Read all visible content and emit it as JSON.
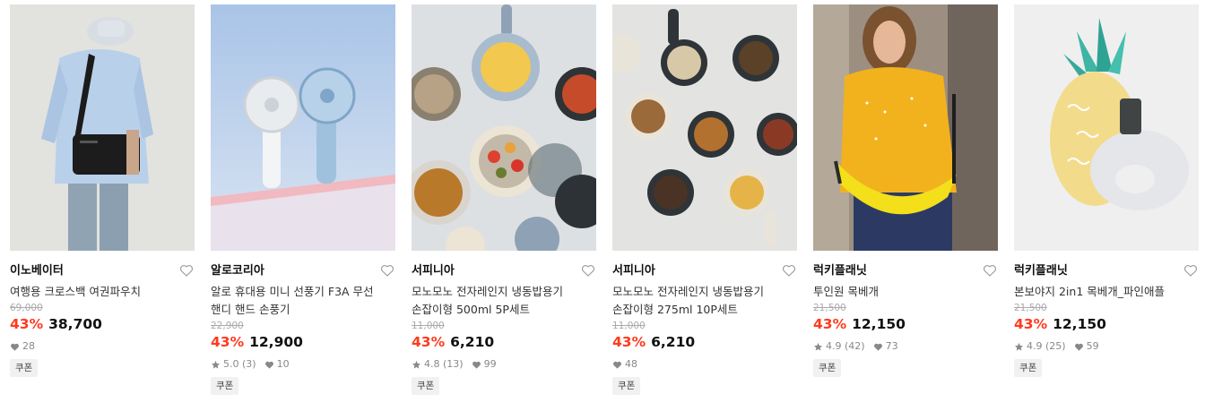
{
  "products": [
    {
      "brand": "이노베이터",
      "title": "여행용 크로스백 여권파우치",
      "original_price": "69,000",
      "discount": "43%",
      "price": "38,700",
      "rating": "",
      "review_count": "",
      "likes": "28",
      "badge": "쿠폰"
    },
    {
      "brand": "알로코리아",
      "title": "알로 휴대용 미니 선풍기 F3A 무선 핸디 핸드 손풍기",
      "original_price": "22,900",
      "discount": "43%",
      "price": "12,900",
      "rating": "5.0",
      "review_count": "(3)",
      "likes": "10",
      "badge": "쿠폰"
    },
    {
      "brand": "서피니아",
      "title": "모노모노 전자레인지 냉동밥용기 손잡이형 500ml 5P세트",
      "original_price": "11,000",
      "discount": "43%",
      "price": "6,210",
      "rating": "4.8",
      "review_count": "(13)",
      "likes": "99",
      "badge": "쿠폰"
    },
    {
      "brand": "서피니아",
      "title": "모노모노 전자레인지 냉동밥용기 손잡이형 275ml 10P세트",
      "original_price": "11,000",
      "discount": "43%",
      "price": "6,210",
      "rating": "",
      "review_count": "",
      "likes": "48",
      "badge": "쿠폰"
    },
    {
      "brand": "럭키플래닛",
      "title": "투인원 목베개",
      "original_price": "21,500",
      "discount": "43%",
      "price": "12,150",
      "rating": "4.9",
      "review_count": "(42)",
      "likes": "73",
      "badge": "쿠폰"
    },
    {
      "brand": "럭키플래닛",
      "title": "본보야지 2in1 목베개_파인애플",
      "original_price": "21,500",
      "discount": "43%",
      "price": "12,150",
      "rating": "4.9",
      "review_count": "(25)",
      "likes": "59",
      "badge": "쿠폰"
    }
  ],
  "colors": {
    "discount": "#ff3b1f",
    "original_price": "#aaaaaa",
    "meta": "#888888",
    "badge_bg": "#f1f1f1"
  },
  "icons": {
    "wishlist": "heart-outline-icon",
    "rating": "star-icon",
    "likes": "heart-filled-icon"
  }
}
